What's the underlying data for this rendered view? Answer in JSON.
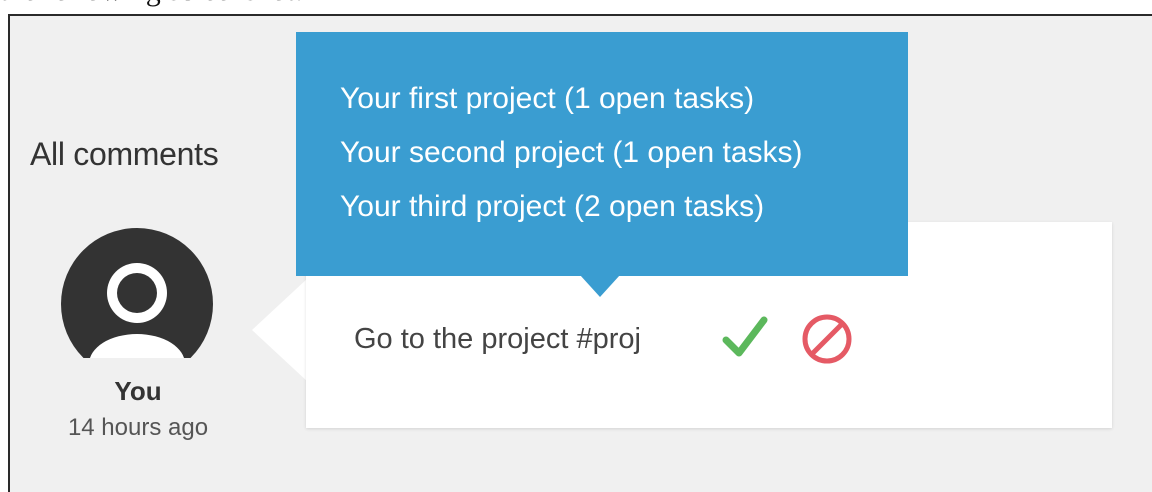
{
  "caption": "the following screenshot:",
  "comments": {
    "title": "All comments",
    "author": {
      "name": "You",
      "time": "14 hours ago"
    },
    "input_value": "Go to the project #proj"
  },
  "suggestions": [
    {
      "label": "Your first project (1 open tasks)"
    },
    {
      "label": "Your second project (1 open tasks)"
    },
    {
      "label": "Your third project (2 open tasks)"
    }
  ],
  "icons": {
    "accept": "check-icon",
    "cancel": "cancel-icon"
  },
  "colors": {
    "popup_bg": "#3a9dd1",
    "accept": "#5cb85c",
    "cancel": "#e55a65",
    "avatar": "#333333",
    "panel_bg": "#f0f0f0"
  }
}
